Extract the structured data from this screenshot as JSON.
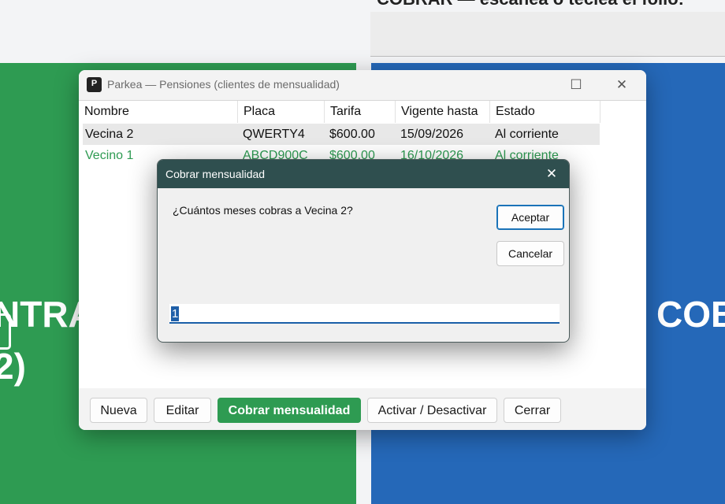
{
  "background": {
    "hint_text": "COBRAR — escanea o teclea el folio:",
    "left_button_text_1": "NTRA",
    "left_button_text_2": "2)",
    "right_button_text": "COB"
  },
  "window": {
    "title": "Parkea — Pensiones (clientes de mensualidad)",
    "app_icon_letter": "P",
    "controls": {
      "minimize": "—",
      "maximize": "☐",
      "close": "✕"
    }
  },
  "table": {
    "columns": [
      "Nombre",
      "Placa",
      "Tarifa",
      "Vigente hasta",
      "Estado"
    ],
    "rows": [
      {
        "nombre": "Vecina 2",
        "placa": "QWERTY4",
        "tarifa": "$600.00",
        "vigente": "15/09/2026",
        "estado": "Al corriente",
        "selected": true
      },
      {
        "nombre": "Vecino 1",
        "placa": "ABCD900C",
        "tarifa": "$600.00",
        "vigente": "16/10/2026",
        "estado": "Al corriente",
        "selected": false
      }
    ]
  },
  "buttons": {
    "nueva": "Nueva",
    "editar": "Editar",
    "cobrar": "Cobrar mensualidad",
    "activar": "Activar / Desactivar",
    "cerrar": "Cerrar"
  },
  "dialog": {
    "title": "Cobrar mensualidad",
    "close": "✕",
    "prompt": "¿Cuántos meses cobras a Vecina 2?",
    "ok": "Aceptar",
    "cancel": "Cancelar",
    "input_value": "1"
  },
  "colors": {
    "accent_green": "#2e9b52",
    "accent_blue": "#2568b8",
    "dialog_title": "#2f4f4f",
    "inactive_row_text": "#2e9b52"
  }
}
